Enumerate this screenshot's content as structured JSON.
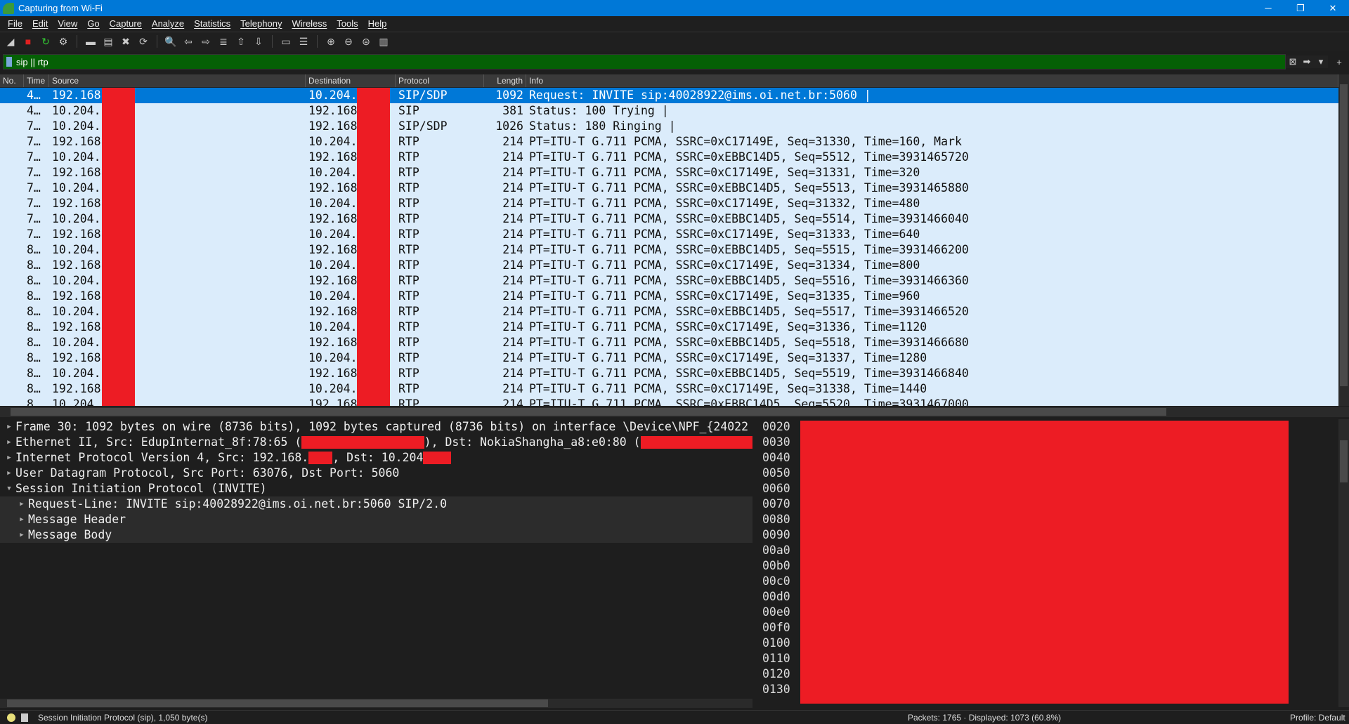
{
  "window": {
    "title": "Capturing from Wi-Fi",
    "controls": [
      "─",
      "❐",
      "✕"
    ]
  },
  "menu": [
    "File",
    "Edit",
    "View",
    "Go",
    "Capture",
    "Analyze",
    "Statistics",
    "Telephony",
    "Wireless",
    "Tools",
    "Help"
  ],
  "toolbar": [
    "start-capture",
    "stop-capture",
    "restart-capture",
    "capture-options",
    "open-file",
    "save-file",
    "close-file",
    "reload-file",
    "find-packet",
    "go-back",
    "go-forward",
    "go-to-packet",
    "go-first",
    "go-last",
    "auto-scroll",
    "colorize",
    "zoom-in",
    "zoom-out",
    "zoom-normal",
    "resize-columns"
  ],
  "filter": {
    "value": "sip || rtp",
    "color": "#056005"
  },
  "columns": [
    "No.",
    "Time",
    "Source",
    "Destination",
    "Protocol",
    "Length",
    "Info"
  ],
  "packets": [
    [
      "",
      "4…",
      "192.168",
      "10.204.",
      "SIP/SDP",
      "1092",
      "Request: INVITE sip:40028922@ims.oi.net.br:5060 |"
    ],
    [
      "",
      "4…",
      "10.204.",
      "192.168",
      "SIP",
      "381",
      "Status: 100 Trying |"
    ],
    [
      "",
      "7…",
      "10.204.",
      "192.168",
      "SIP/SDP",
      "1026",
      "Status: 180 Ringing |"
    ],
    [
      "",
      "7…",
      "192.168",
      "10.204.",
      "RTP",
      "214",
      "PT=ITU-T G.711 PCMA, SSRC=0xC17149E, Seq=31330, Time=160, Mark"
    ],
    [
      "",
      "7…",
      "10.204.",
      "192.168",
      "RTP",
      "214",
      "PT=ITU-T G.711 PCMA, SSRC=0xEBBC14D5, Seq=5512, Time=3931465720"
    ],
    [
      "",
      "7…",
      "192.168",
      "10.204.",
      "RTP",
      "214",
      "PT=ITU-T G.711 PCMA, SSRC=0xC17149E, Seq=31331, Time=320"
    ],
    [
      "",
      "7…",
      "10.204.",
      "192.168",
      "RTP",
      "214",
      "PT=ITU-T G.711 PCMA, SSRC=0xEBBC14D5, Seq=5513, Time=3931465880"
    ],
    [
      "",
      "7…",
      "192.168",
      "10.204.",
      "RTP",
      "214",
      "PT=ITU-T G.711 PCMA, SSRC=0xC17149E, Seq=31332, Time=480"
    ],
    [
      "",
      "7…",
      "10.204.",
      "192.168",
      "RTP",
      "214",
      "PT=ITU-T G.711 PCMA, SSRC=0xEBBC14D5, Seq=5514, Time=3931466040"
    ],
    [
      "",
      "7…",
      "192.168",
      "10.204.",
      "RTP",
      "214",
      "PT=ITU-T G.711 PCMA, SSRC=0xC17149E, Seq=31333, Time=640"
    ],
    [
      "",
      "8…",
      "10.204.",
      "192.168",
      "RTP",
      "214",
      "PT=ITU-T G.711 PCMA, SSRC=0xEBBC14D5, Seq=5515, Time=3931466200"
    ],
    [
      "",
      "8…",
      "192.168",
      "10.204.",
      "RTP",
      "214",
      "PT=ITU-T G.711 PCMA, SSRC=0xC17149E, Seq=31334, Time=800"
    ],
    [
      "",
      "8…",
      "10.204.",
      "192.168",
      "RTP",
      "214",
      "PT=ITU-T G.711 PCMA, SSRC=0xEBBC14D5, Seq=5516, Time=3931466360"
    ],
    [
      "",
      "8…",
      "192.168",
      "10.204.",
      "RTP",
      "214",
      "PT=ITU-T G.711 PCMA, SSRC=0xC17149E, Seq=31335, Time=960"
    ],
    [
      "",
      "8…",
      "10.204.",
      "192.168",
      "RTP",
      "214",
      "PT=ITU-T G.711 PCMA, SSRC=0xEBBC14D5, Seq=5517, Time=3931466520"
    ],
    [
      "",
      "8…",
      "192.168",
      "10.204.",
      "RTP",
      "214",
      "PT=ITU-T G.711 PCMA, SSRC=0xC17149E, Seq=31336, Time=1120"
    ],
    [
      "",
      "8…",
      "10.204.",
      "192.168",
      "RTP",
      "214",
      "PT=ITU-T G.711 PCMA, SSRC=0xEBBC14D5, Seq=5518, Time=3931466680"
    ],
    [
      "",
      "8…",
      "192.168",
      "10.204.",
      "RTP",
      "214",
      "PT=ITU-T G.711 PCMA, SSRC=0xC17149E, Seq=31337, Time=1280"
    ],
    [
      "",
      "8…",
      "10.204.",
      "192.168",
      "RTP",
      "214",
      "PT=ITU-T G.711 PCMA, SSRC=0xEBBC14D5, Seq=5519, Time=3931466840"
    ],
    [
      "",
      "8…",
      "192.168",
      "10.204.",
      "RTP",
      "214",
      "PT=ITU-T G.711 PCMA, SSRC=0xC17149E, Seq=31338, Time=1440"
    ],
    [
      "",
      "8…",
      "10.204.",
      "192.168",
      "RTP",
      "214",
      "PT=ITU-T G.711 PCMA, SSRC=0xEBBC14D5, Seq=5520, Time=3931467000"
    ]
  ],
  "selected_row": 0,
  "details": [
    {
      "parts": [
        "Frame 30: 1092 bytes on wire (8736 bits), 1092 bytes captured (8736 bits) on interface \\Device\\NPF_{24022"
      ],
      "expanded": false,
      "level": 0
    },
    {
      "parts": [
        "Ethernet II, Src: EdupInternat_8f:78:65 (",
        "), Dst: NokiaShangha_a8:e0:80 (",
        ""
      ],
      "expanded": false,
      "level": 0
    },
    {
      "parts": [
        "Internet Protocol Version 4, Src: 192.168.",
        ", Dst: 10.204",
        ""
      ],
      "expanded": false,
      "level": 0
    },
    {
      "parts": [
        "User Datagram Protocol, Src Port: 63076, Dst Port: 5060"
      ],
      "expanded": false,
      "level": 0
    },
    {
      "parts": [
        "Session Initiation Protocol (INVITE)"
      ],
      "expanded": true,
      "level": 0
    },
    {
      "parts": [
        "Request-Line: INVITE sip:40028922@ims.oi.net.br:5060 SIP/2.0"
      ],
      "expanded": false,
      "level": 1
    },
    {
      "parts": [
        "Message Header"
      ],
      "expanded": false,
      "level": 1
    },
    {
      "parts": [
        "Message Body"
      ],
      "expanded": false,
      "level": 1
    }
  ],
  "byte_offsets": [
    "0020",
    "0030",
    "0040",
    "0050",
    "0060",
    "0070",
    "0080",
    "0090",
    "00a0",
    "00b0",
    "00c0",
    "00d0",
    "00e0",
    "00f0",
    "0100",
    "0110",
    "0120",
    "0130"
  ],
  "status": {
    "field": "Session Initiation Protocol (sip), 1,050 byte(s)",
    "packets": "Packets: 1765 · Displayed: 1073 (60.8%)",
    "profile": "Profile: Default"
  },
  "colors": {
    "selected": "#0078d7",
    "row_bg": "#dbecfb",
    "redaction": "#ed1c24"
  }
}
